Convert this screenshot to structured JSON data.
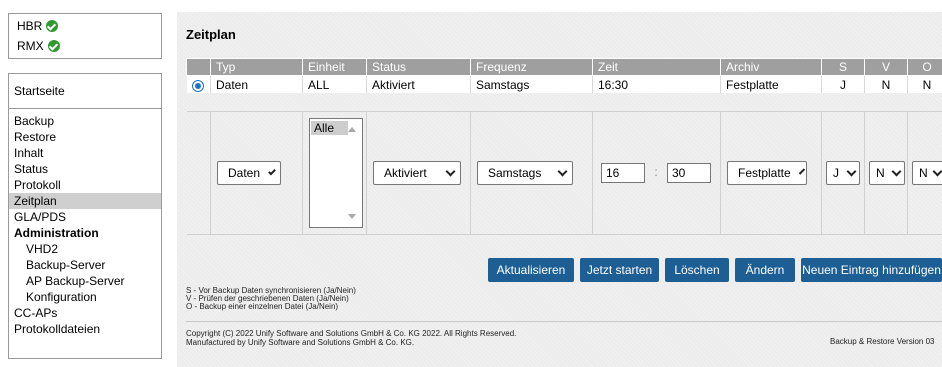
{
  "status": {
    "items": [
      {
        "label": "HBR",
        "icon": "check-circle-icon",
        "color": "#2f9a2f"
      },
      {
        "label": "RMX",
        "icon": "check-circle-icon",
        "color": "#2f9a2f"
      }
    ]
  },
  "sidebar": {
    "home": "Startseite",
    "items": [
      {
        "label": "Backup"
      },
      {
        "label": "Restore"
      },
      {
        "label": "Inhalt"
      },
      {
        "label": "Status"
      },
      {
        "label": "Protokoll"
      },
      {
        "label": "Zeitplan",
        "active": true
      },
      {
        "label": "GLA/PDS"
      },
      {
        "label": "Administration",
        "section": true
      },
      {
        "label": "VHD2",
        "sub": true
      },
      {
        "label": "Backup-Server",
        "sub": true
      },
      {
        "label": "AP Backup-Server",
        "sub": true
      },
      {
        "label": "Konfiguration",
        "sub": true
      },
      {
        "label": "CC-APs"
      },
      {
        "label": "Protokolldateien"
      }
    ]
  },
  "main": {
    "title": "Zeitplan",
    "columns": [
      "Typ",
      "Einheit",
      "Status",
      "Frequenz",
      "Zeit",
      "Archiv",
      "S",
      "V",
      "O"
    ],
    "row": {
      "selected": true,
      "typ": "Daten",
      "einheit": "ALL",
      "status": "Aktiviert",
      "frequenz": "Samstags",
      "zeit": "16:30",
      "archiv": "Festplatte",
      "s": "J",
      "v": "N",
      "o": "N"
    },
    "edit": {
      "typ": "Daten",
      "einheit_option": "Alle",
      "status": "Aktiviert",
      "frequenz": "Samstags",
      "hour": "16",
      "minute": "30",
      "colon": ":",
      "archiv": "Festplatte",
      "s": "J",
      "v": "N",
      "o": "N"
    },
    "buttons": {
      "update": "Aktualisieren",
      "start": "Jetzt starten",
      "delete": "Löschen",
      "change": "Ändern",
      "add": "Neuen Eintrag hinzufügen"
    },
    "legend": [
      "S - Vor Backup Daten synchronisieren (Ja/Nein)",
      "V - Prüfen der geschriebenen Daten (Ja/Nein)",
      "O - Backup einer einzelnen Datei (Ja/Nein)"
    ],
    "copyright": [
      "Copyright (C) 2022 Unify Software and Solutions GmbH & Co. KG 2022. All Rights Reserved.",
      "Manufactured by Unify Software and Solutions GmbH & Co. KG."
    ],
    "version": "Backup & Restore Version 03"
  },
  "colors": {
    "button": "#1d5f94",
    "header": "#9f9f9f",
    "active_menu": "#cfcfcf",
    "radio": "#1e72c8"
  }
}
